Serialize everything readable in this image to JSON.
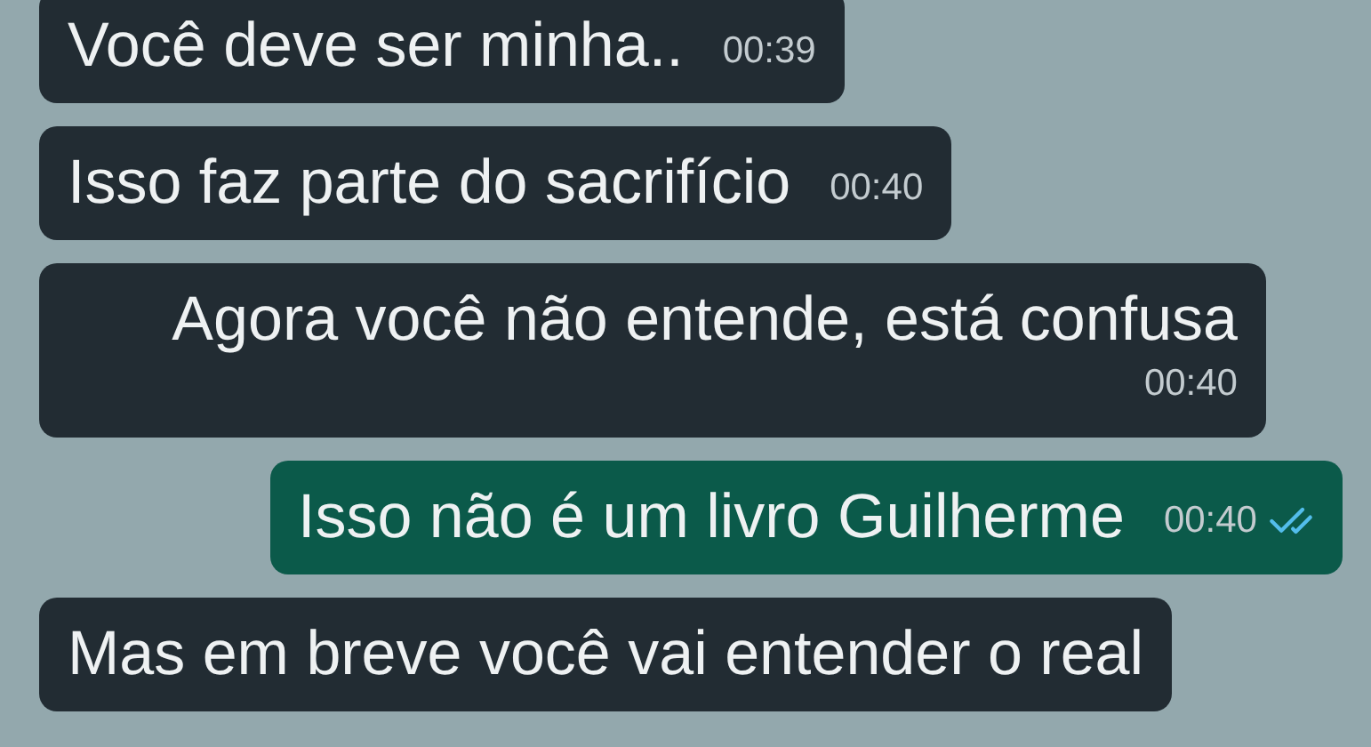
{
  "messages": [
    {
      "kind": "received",
      "text": "Você deve ser minha..",
      "time": "00:39"
    },
    {
      "kind": "received",
      "text": "Isso faz parte do sacrifício",
      "time": "00:40"
    },
    {
      "kind": "received",
      "text": "Agora você não entende, está confusa",
      "time": "00:40"
    },
    {
      "kind": "sent",
      "text": "Isso não é um livro Guilherme",
      "time": "00:40",
      "read": true
    },
    {
      "kind": "received",
      "text": "Mas em breve você vai entender o real"
    }
  ]
}
